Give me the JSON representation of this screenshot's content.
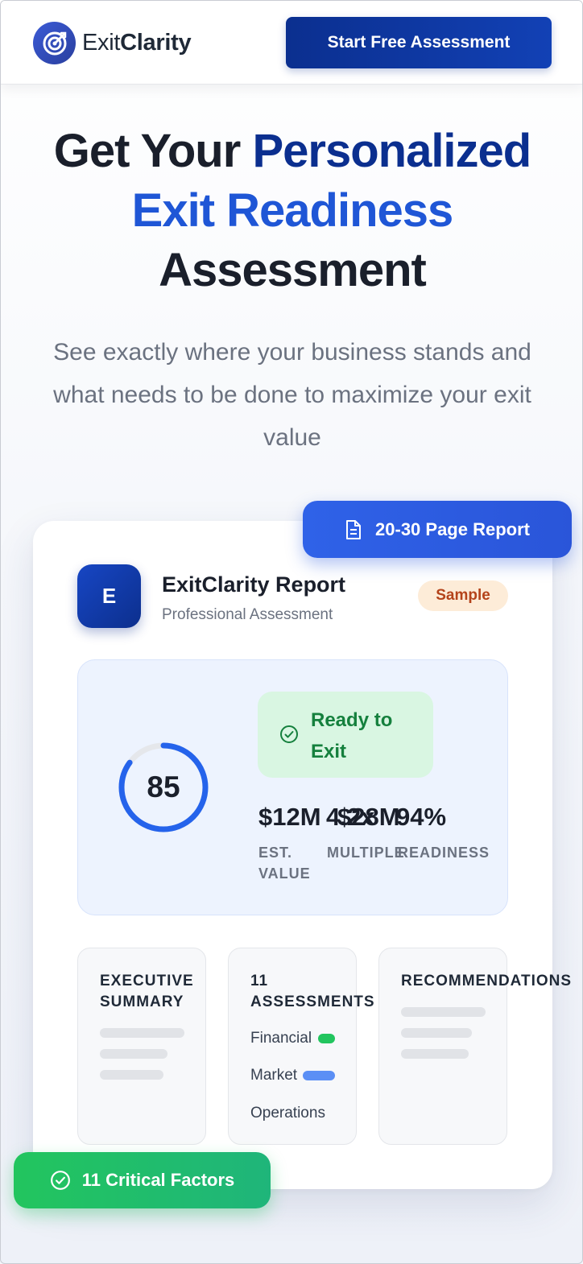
{
  "header": {
    "logo_text_light": "Exit",
    "logo_text_bold": "Clarity",
    "cta_label": "Start Free Assessment"
  },
  "hero": {
    "title_part1": "Get Your ",
    "title_part2": "Personalized",
    "title_part3": "Exit Readiness",
    "title_part4": "Assessment",
    "subtitle": "See exactly where your business stands and what needs to be done to maximize your exit value"
  },
  "badges": {
    "report_pages": "20-30 Page Report",
    "critical_factors": "11 Critical Factors"
  },
  "report": {
    "avatar_letter": "E",
    "title": "ExitClarity Report",
    "subtitle": "Professional Assessment",
    "sample_label": "Sample",
    "score": "85",
    "score_progress": 0.85,
    "status": "Ready to Exit",
    "stats": [
      {
        "value": "$12M",
        "label": "EST. VALUE"
      },
      {
        "value": "4.2x",
        "label": "MULTIPLE"
      },
      {
        "value": "$28M",
        "label": ""
      },
      {
        "value": "94%",
        "label": "READINESS"
      }
    ],
    "sections": {
      "executive_summary": "EXECUTIVE SUMMARY",
      "assessments": "11 ASSESSMENTS",
      "recommendations": "RECOMMENDATIONS"
    },
    "assessment_items": [
      "Financial",
      "Market",
      "Operations"
    ]
  },
  "colors": {
    "brand_dark": "#0b2f8f",
    "brand_blue": "#1f56d6",
    "success_green": "#22c55e",
    "sample_orange": "#b4431a"
  }
}
